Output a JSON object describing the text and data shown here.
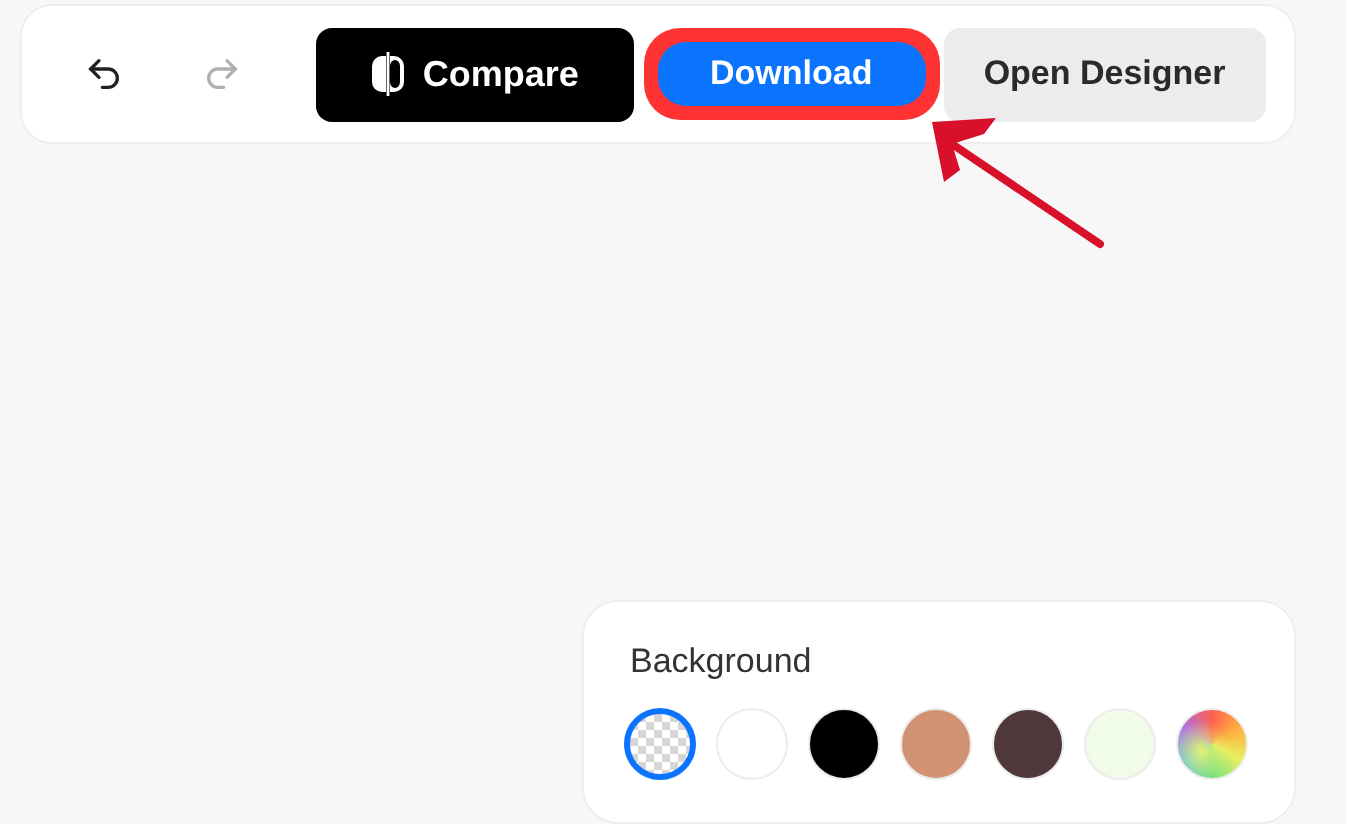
{
  "toolbar": {
    "undo": {
      "disabled": false
    },
    "redo": {
      "disabled": true
    },
    "compare": {
      "label": "Compare"
    },
    "download": {
      "label": "Download",
      "highlighted": true
    },
    "open_designer": {
      "label": "Open Designer"
    }
  },
  "background_panel": {
    "title": "Background",
    "swatches": [
      {
        "kind": "transparent",
        "selected": true
      },
      {
        "kind": "color",
        "color": "#ffffff",
        "selected": false
      },
      {
        "kind": "color",
        "color": "#000000",
        "selected": false
      },
      {
        "kind": "color",
        "color": "#d29374",
        "selected": false
      },
      {
        "kind": "color",
        "color": "#4e3839",
        "selected": false
      },
      {
        "kind": "color",
        "color": "#f1fbe9",
        "selected": false
      },
      {
        "kind": "rainbow",
        "selected": false
      }
    ]
  }
}
